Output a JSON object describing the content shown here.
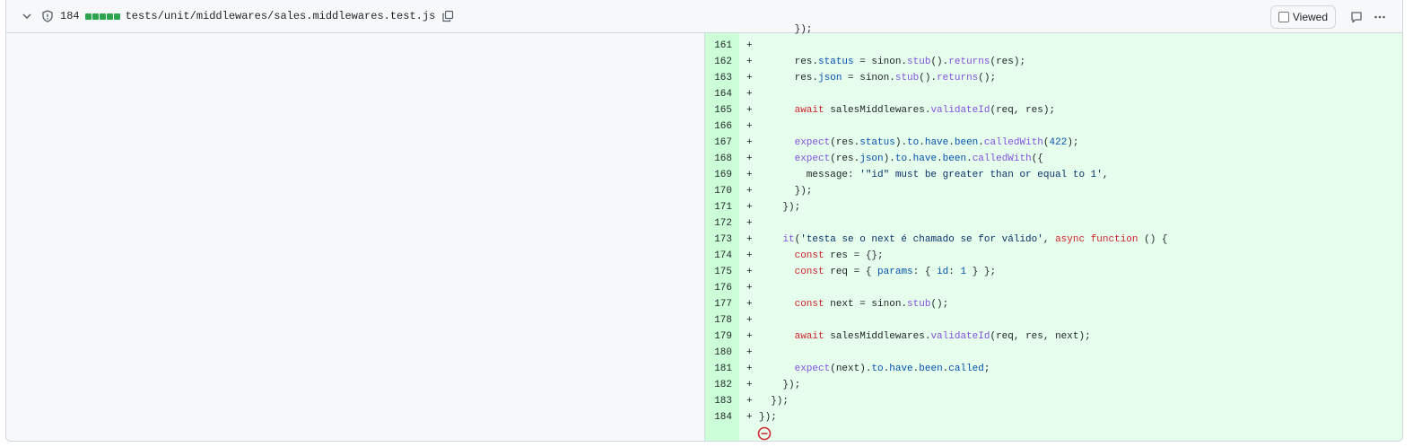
{
  "file": {
    "changes": "184",
    "path": "tests/unit/middlewares/sales.middlewares.test.js",
    "viewed_label": "Viewed",
    "icons": {
      "collapse": "chevron-down-icon",
      "protect": "shield-icon",
      "copy": "copy-icon",
      "comment": "comment-icon",
      "more": "kebab-horizontal-icon",
      "end": "no-entry-icon"
    },
    "colors": {
      "addition_blocks": "#2da44e",
      "added_line_bg": "#e6ffec",
      "added_gutter_bg": "#ccffd8",
      "keyword": "#cf222e",
      "function": "#8250df",
      "property": "#0550ae",
      "string": "#0a3069"
    }
  },
  "diff": {
    "partial_line": "      });",
    "lines": [
      {
        "n": "161",
        "m": "+",
        "t": []
      },
      {
        "n": "162",
        "m": "+",
        "t": [
          [
            "p",
            "      res."
          ],
          [
            "pr",
            "status"
          ],
          [
            "p",
            " = sinon."
          ],
          [
            "fn",
            "stub"
          ],
          [
            "p",
            "()."
          ],
          [
            "fn",
            "returns"
          ],
          [
            "p",
            "(res);"
          ]
        ]
      },
      {
        "n": "163",
        "m": "+",
        "t": [
          [
            "p",
            "      res."
          ],
          [
            "pr",
            "json"
          ],
          [
            "p",
            " = sinon."
          ],
          [
            "fn",
            "stub"
          ],
          [
            "p",
            "()."
          ],
          [
            "fn",
            "returns"
          ],
          [
            "p",
            "();"
          ]
        ]
      },
      {
        "n": "164",
        "m": "+",
        "t": []
      },
      {
        "n": "165",
        "m": "+",
        "t": [
          [
            "p",
            "      "
          ],
          [
            "kw",
            "await"
          ],
          [
            "p",
            " salesMiddlewares."
          ],
          [
            "fn",
            "validateId"
          ],
          [
            "p",
            "(req, res);"
          ]
        ]
      },
      {
        "n": "166",
        "m": "+",
        "t": []
      },
      {
        "n": "167",
        "m": "+",
        "t": [
          [
            "p",
            "      "
          ],
          [
            "fn",
            "expect"
          ],
          [
            "p",
            "(res."
          ],
          [
            "pr",
            "status"
          ],
          [
            "p",
            ")."
          ],
          [
            "pr",
            "to"
          ],
          [
            "p",
            "."
          ],
          [
            "pr",
            "have"
          ],
          [
            "p",
            "."
          ],
          [
            "pr",
            "been"
          ],
          [
            "p",
            "."
          ],
          [
            "fn",
            "calledWith"
          ],
          [
            "p",
            "("
          ],
          [
            "pr",
            "422"
          ],
          [
            "p",
            ");"
          ]
        ]
      },
      {
        "n": "168",
        "m": "+",
        "t": [
          [
            "p",
            "      "
          ],
          [
            "fn",
            "expect"
          ],
          [
            "p",
            "(res."
          ],
          [
            "pr",
            "json"
          ],
          [
            "p",
            ")."
          ],
          [
            "pr",
            "to"
          ],
          [
            "p",
            "."
          ],
          [
            "pr",
            "have"
          ],
          [
            "p",
            "."
          ],
          [
            "pr",
            "been"
          ],
          [
            "p",
            "."
          ],
          [
            "fn",
            "calledWith"
          ],
          [
            "p",
            "({"
          ]
        ]
      },
      {
        "n": "169",
        "m": "+",
        "t": [
          [
            "p",
            "        message: "
          ],
          [
            "st",
            "'\"id\" must be greater than or equal to 1'"
          ],
          [
            "p",
            ","
          ]
        ]
      },
      {
        "n": "170",
        "m": "+",
        "t": [
          [
            "p",
            "      });"
          ]
        ]
      },
      {
        "n": "171",
        "m": "+",
        "t": [
          [
            "p",
            "    });"
          ]
        ]
      },
      {
        "n": "172",
        "m": "+",
        "t": []
      },
      {
        "n": "173",
        "m": "+",
        "t": [
          [
            "p",
            "    "
          ],
          [
            "fn",
            "it"
          ],
          [
            "p",
            "("
          ],
          [
            "st",
            "'testa se o next é chamado se for válido'"
          ],
          [
            "p",
            ", "
          ],
          [
            "kw",
            "async"
          ],
          [
            "p",
            " "
          ],
          [
            "kw",
            "function"
          ],
          [
            "p",
            " () {"
          ]
        ]
      },
      {
        "n": "174",
        "m": "+",
        "t": [
          [
            "p",
            "      "
          ],
          [
            "kw",
            "const"
          ],
          [
            "p",
            " res = {};"
          ]
        ]
      },
      {
        "n": "175",
        "m": "+",
        "t": [
          [
            "p",
            "      "
          ],
          [
            "kw",
            "const"
          ],
          [
            "p",
            " req = { "
          ],
          [
            "pr",
            "params"
          ],
          [
            "p",
            ": { "
          ],
          [
            "pr",
            "id"
          ],
          [
            "p",
            ": "
          ],
          [
            "pr",
            "1"
          ],
          [
            "p",
            " } };"
          ]
        ]
      },
      {
        "n": "176",
        "m": "+",
        "t": []
      },
      {
        "n": "177",
        "m": "+",
        "t": [
          [
            "p",
            "      "
          ],
          [
            "kw",
            "const"
          ],
          [
            "p",
            " next = sinon."
          ],
          [
            "fn",
            "stub"
          ],
          [
            "p",
            "();"
          ]
        ]
      },
      {
        "n": "178",
        "m": "+",
        "t": []
      },
      {
        "n": "179",
        "m": "+",
        "t": [
          [
            "p",
            "      "
          ],
          [
            "kw",
            "await"
          ],
          [
            "p",
            " salesMiddlewares."
          ],
          [
            "fn",
            "validateId"
          ],
          [
            "p",
            "(req, res, next);"
          ]
        ]
      },
      {
        "n": "180",
        "m": "+",
        "t": []
      },
      {
        "n": "181",
        "m": "+",
        "t": [
          [
            "p",
            "      "
          ],
          [
            "fn",
            "expect"
          ],
          [
            "p",
            "(next)."
          ],
          [
            "pr",
            "to"
          ],
          [
            "p",
            "."
          ],
          [
            "pr",
            "have"
          ],
          [
            "p",
            "."
          ],
          [
            "pr",
            "been"
          ],
          [
            "p",
            "."
          ],
          [
            "pr",
            "called"
          ],
          [
            "p",
            ";"
          ]
        ]
      },
      {
        "n": "182",
        "m": "+",
        "t": [
          [
            "p",
            "    });"
          ]
        ]
      },
      {
        "n": "183",
        "m": "+",
        "t": [
          [
            "p",
            "  });"
          ]
        ]
      },
      {
        "n": "184",
        "m": "+",
        "t": [
          [
            "p",
            "});"
          ]
        ]
      }
    ]
  }
}
